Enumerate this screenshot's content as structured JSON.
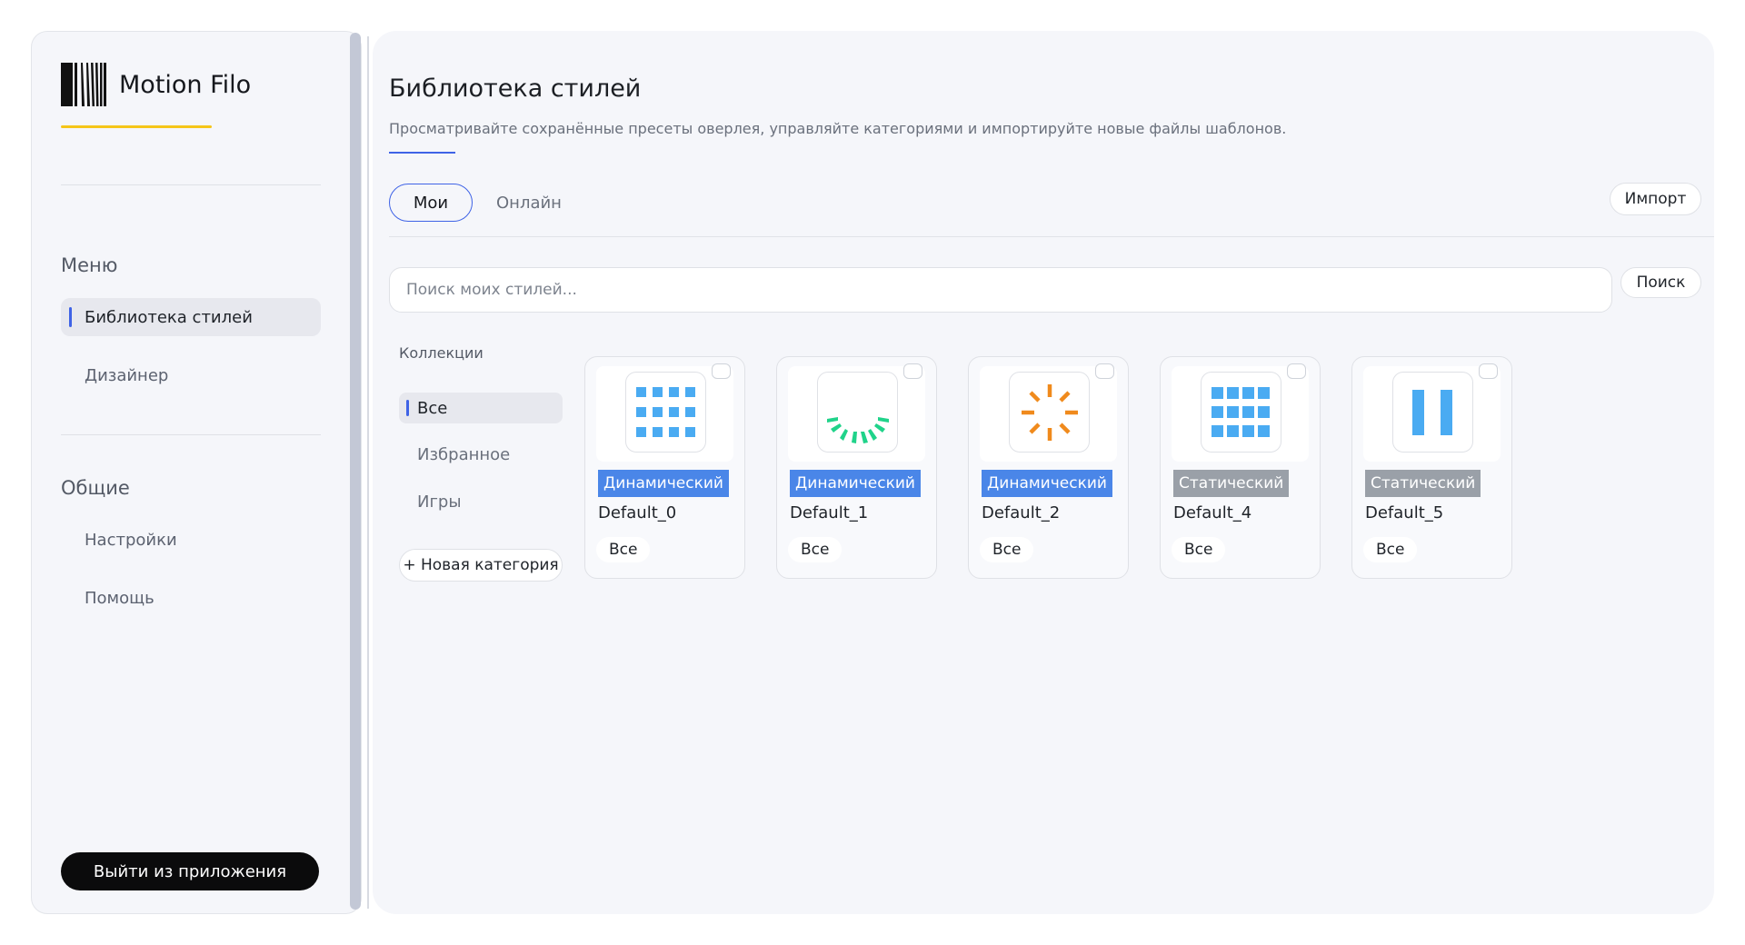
{
  "app": {
    "name": "Motion Filo"
  },
  "sidebar": {
    "menu_title": "Меню",
    "menu_items": [
      {
        "label": "Библиотека стилей",
        "active": true
      },
      {
        "label": "Дизайнер",
        "active": false
      }
    ],
    "general_title": "Общие",
    "general_items": [
      {
        "label": "Настройки"
      },
      {
        "label": "Помощь"
      }
    ],
    "exit_label": "Выйти из приложения"
  },
  "main": {
    "title": "Библиотека стилей",
    "description": "Просматривайте сохранённые пресеты оверлея, управляйте категориями и импортируйте новые файлы шаблонов.",
    "tabs": [
      {
        "label": "Мои",
        "active": true
      },
      {
        "label": "Онлайн",
        "active": false
      }
    ],
    "import_label": "Импорт",
    "search": {
      "placeholder": "Поиск моих стилей...",
      "value": "",
      "button_label": "Поиск"
    },
    "collections": {
      "title": "Коллекции",
      "items": [
        {
          "label": "Все",
          "active": true
        },
        {
          "label": "Избранное",
          "active": false
        },
        {
          "label": "Игры",
          "active": false
        }
      ],
      "new_category_label": "+ Новая категория"
    },
    "styles": [
      {
        "name": "Default_0",
        "type": "Динамический",
        "category": "Все",
        "icon": "grid-icon",
        "selected": false
      },
      {
        "name": "Default_1",
        "type": "Динамический",
        "category": "Все",
        "icon": "arc-spinner-icon",
        "selected": false
      },
      {
        "name": "Default_2",
        "type": "Динамический",
        "category": "Все",
        "icon": "radial-spinner-icon",
        "selected": false
      },
      {
        "name": "Default_4",
        "type": "Статический",
        "category": "Все",
        "icon": "grid-icon",
        "selected": false
      },
      {
        "name": "Default_5",
        "type": "Статический",
        "category": "Все",
        "icon": "pause-icon",
        "selected": false
      }
    ]
  },
  "colors": {
    "accent": "#3f63e6",
    "logo_underline": "#f5c518",
    "badge_dynamic": "#4a86e8",
    "badge_static": "#9aa0a8",
    "icon_blue": "#4aabf2",
    "icon_green": "#20d38a",
    "icon_orange": "#f08a1c",
    "exit_button": "#0b0b0c"
  }
}
